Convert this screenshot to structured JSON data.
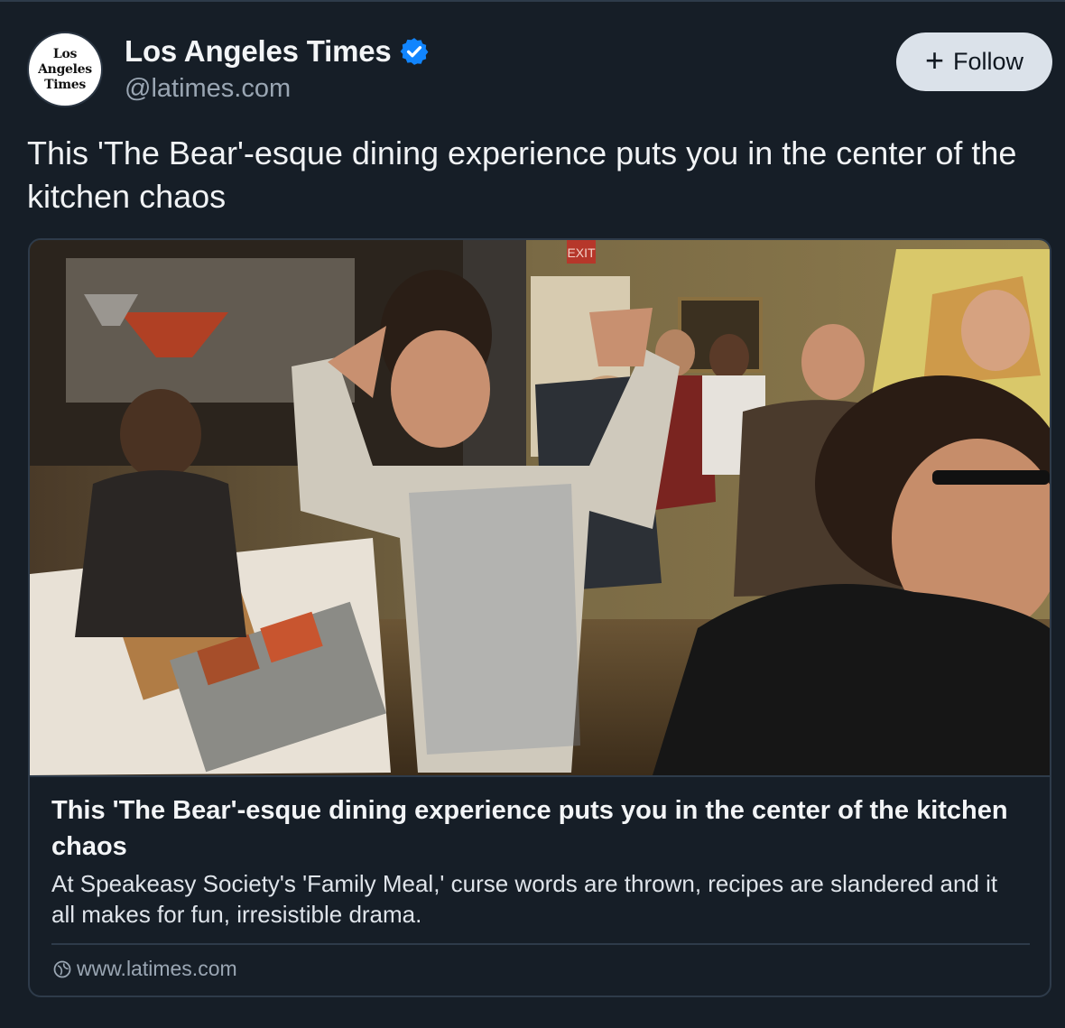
{
  "post": {
    "author": {
      "name": "Los Angeles Times",
      "handle": "@latimes.com",
      "avatar_text": "Los Angeles Times",
      "verified": true
    },
    "follow_button": {
      "label": "Follow",
      "icon": "plus-icon"
    },
    "text": "This 'The Bear'-esque dining experience puts you in the center of the kitchen chaos",
    "link_card": {
      "image_description_icon": "photo",
      "title": "This 'The Bear'-esque dining experience puts you in the center of the kitchen chaos",
      "description": "At Speakeasy Society's 'Family Meal,' curse words are thrown, recipes are slandered and it all makes for fun, irresistible drama.",
      "domain": "www.latimes.com",
      "domain_icon": "globe-icon",
      "image_sign_text": "EXIT"
    }
  },
  "colors": {
    "background": "#161e27",
    "border": "#2e3b4a",
    "verified_blue": "#1185fe",
    "follow_button_bg": "#dbe2ea",
    "muted_text": "#9aa6b3"
  }
}
